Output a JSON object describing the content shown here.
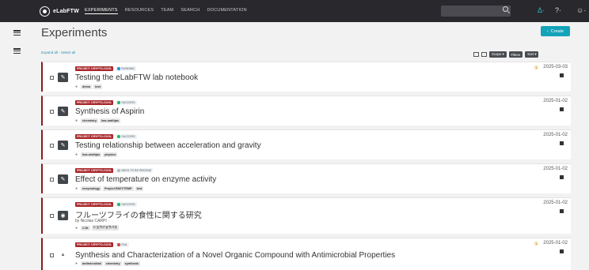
{
  "nav": {
    "brand": "eLabFTW",
    "links": [
      "EXPERIMENTS",
      "RESOURCES",
      "TEAM",
      "SEARCH",
      "DOCUMENTATION"
    ]
  },
  "top_icons": {
    "bell": "Δ·",
    "help": "?·",
    "user": "☺·"
  },
  "page": {
    "title": "Experiments",
    "create_label": "Create",
    "create_icon": "‹",
    "expand_text": "Expand all - Select all"
  },
  "toolbar": {
    "scope": "Scope ▾",
    "filters": "Filters",
    "sort": "Sort ▾"
  },
  "entries": [
    {
      "category": "PROJECT CRYPTO-COOL",
      "status": "RUNNING",
      "status_color": "#2f8fd6",
      "title": "Testing the eLabFTW lab notebook",
      "tags": [
        "demo",
        "test"
      ],
      "date": "2025-03-03",
      "lock_count": "1",
      "action_icon": "✎"
    },
    {
      "category": "PROJECT CRYPTO-COOL",
      "status": "SUCCESS",
      "status_color": "#2fb36a",
      "title": "Synthesis of Aspirin",
      "tags": [
        "chemistry",
        "has-mathjax"
      ],
      "date": "2025-01-02",
      "action_icon": "✎"
    },
    {
      "category": "PROJECT CRYPTO-COOL",
      "status": "SUCCESS",
      "status_color": "#2fb36a",
      "title": "Testing relationship between acceleration and gravity",
      "tags": [
        "has-mathjax",
        "physics"
      ],
      "date": "2025-01-02",
      "action_icon": "✎"
    },
    {
      "category": "PROJECT CRYPTO-COOL",
      "status": "NEED TO BE REDONE",
      "status_color": "#bbbbbb",
      "title": "Effect of temperature on enzyme activity",
      "tags": [
        "enzymology",
        "Project ENZYTEMP",
        "test"
      ],
      "date": "2025-01-02",
      "action_icon": "✎"
    },
    {
      "category": "PROJECT CRYPTO-COOL",
      "status": "SUCCESS",
      "status_color": "#2fb36a",
      "title": "フルーツフライの食性に関する研究",
      "author": "by Nicolas CARPI",
      "tags": [
        "CJK",
        "ショウジョウバエ"
      ],
      "date": "2025-01-02",
      "action_icon": "◉"
    },
    {
      "category": "PROJECT CRYPTO-COOL",
      "status": "FAIL",
      "status_color": "#d64545",
      "title": "Synthesis and Characterization of a Novel Organic Compound with Antimicrobial Properties",
      "tags": [
        "antimicrobial",
        "chemistry",
        "synthesis"
      ],
      "date": "2025-01-02",
      "lock_count": "1",
      "action_icon": "▲"
    }
  ]
}
